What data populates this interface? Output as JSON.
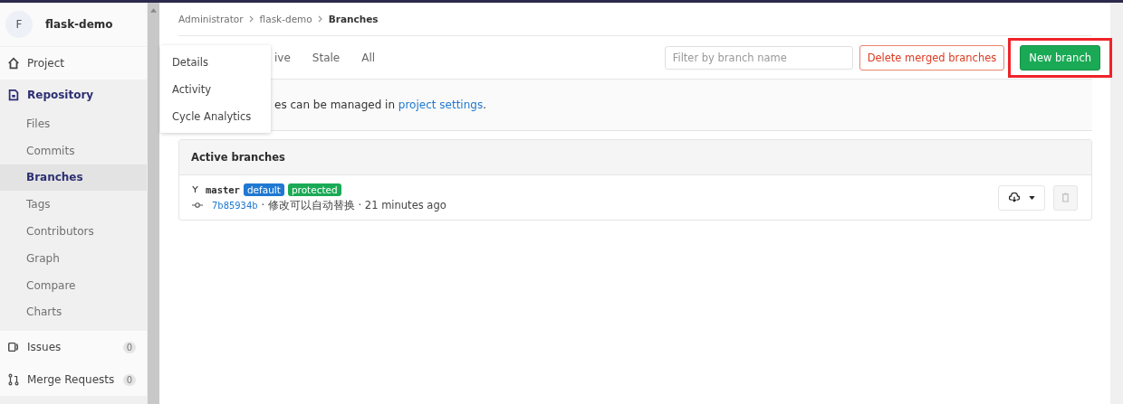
{
  "project": {
    "avatar": "F",
    "name": "flask-demo"
  },
  "sidebar": {
    "items": [
      {
        "label": "Project",
        "kind": "home",
        "selected": false
      },
      {
        "label": "Repository",
        "kind": "repo",
        "selected": true,
        "children": [
          {
            "label": "Files",
            "selected": false
          },
          {
            "label": "Commits",
            "selected": false
          },
          {
            "label": "Branches",
            "selected": true
          },
          {
            "label": "Tags",
            "selected": false
          },
          {
            "label": "Contributors",
            "selected": false
          },
          {
            "label": "Graph",
            "selected": false
          },
          {
            "label": "Compare",
            "selected": false
          },
          {
            "label": "Charts",
            "selected": false
          }
        ]
      },
      {
        "label": "Issues",
        "kind": "issues",
        "selected": false,
        "count": "0"
      },
      {
        "label": "Merge Requests",
        "kind": "merge",
        "selected": false,
        "count": "0"
      }
    ]
  },
  "breadcrumbs": [
    "Administrator",
    "flask-demo",
    "Branches"
  ],
  "flyout_menu": [
    "Details",
    "Activity",
    "Cycle Analytics"
  ],
  "tabs": [
    {
      "label": "ive"
    },
    {
      "label": "Stale"
    },
    {
      "label": "All"
    }
  ],
  "search": {
    "placeholder": "Filter by branch name"
  },
  "delete_button": "Delete merged branches",
  "new_button": {
    "label": "New branch",
    "highlighted": true
  },
  "info": {
    "text": "es can be managed in",
    "link": "project settings",
    "end": "."
  },
  "card": {
    "title": "Active branches",
    "branches": [
      {
        "name": "master",
        "badges": [
          {
            "label": "default",
            "color": "#1f78d1"
          },
          {
            "label": "protected",
            "color": "#1aaa55"
          }
        ],
        "sha": "7b85934b",
        "message": "· 修改可以自动替换 · 21 minutes ago"
      }
    ]
  }
}
